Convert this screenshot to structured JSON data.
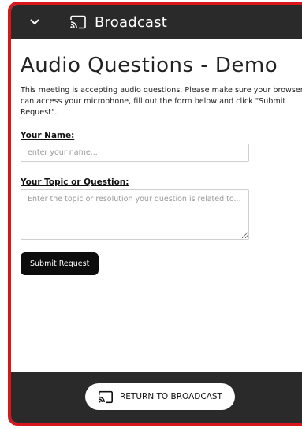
{
  "topbar": {
    "title": "Broadcast",
    "chevron_icon": "chevron-down-icon",
    "cast_icon": "cast-icon"
  },
  "main": {
    "heading": "Audio Questions - Demo",
    "intro": "This meeting is accepting audio questions. Please make sure your browser can access your microphone, fill out the form below and click \"Submit Request\".",
    "name_label": "Your Name:",
    "name_placeholder": "enter your name...",
    "name_value": "",
    "topic_label": "Your Topic or Question:",
    "topic_placeholder": "Enter the topic or resolution your question is related to...",
    "topic_value": "",
    "submit_label": "Submit Request"
  },
  "bottombar": {
    "return_label": "RETURN TO BROADCAST"
  },
  "colors": {
    "frame_border": "#d7171b",
    "bars": "#2a2a2a",
    "button_dark": "#0c0c0c"
  }
}
